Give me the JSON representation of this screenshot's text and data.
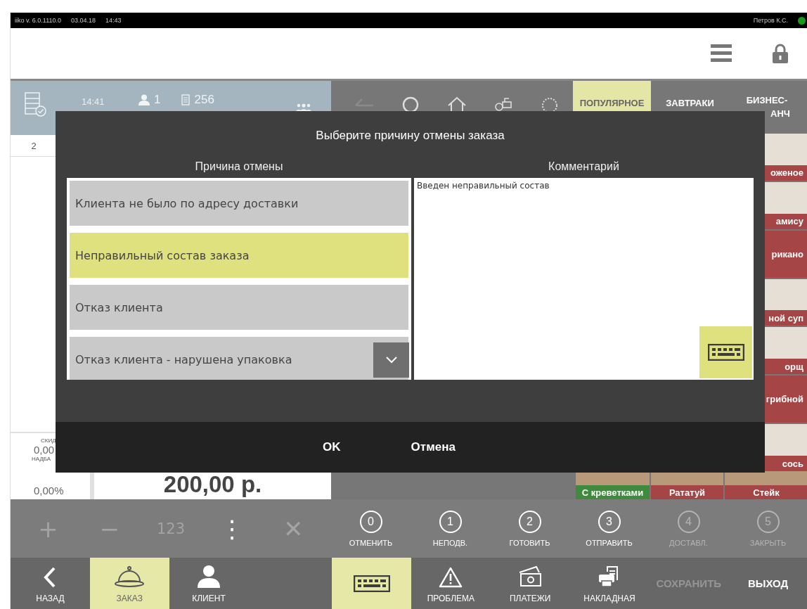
{
  "status_bar": {
    "app_version": "iiko  v. 6.0.1110.0",
    "date": "03.04.18",
    "time": "14:43",
    "user": "Петров К.С.",
    "online": true
  },
  "order": {
    "guests": "1",
    "order_number": "256",
    "time": "14:41",
    "row_number": "2",
    "discount_label": "СКИД",
    "discount_value": "0,00",
    "surcharge_label": "НАДБА",
    "surcharge_value": "0,00%",
    "total": "200,00 р."
  },
  "menu": {
    "categories": [
      {
        "lines": [
          "ПОПУЛЯРНОЕ"
        ],
        "selected": true
      },
      {
        "lines": [
          "ЗАВТРАКИ"
        ],
        "selected": false
      },
      {
        "lines": [
          "БИЗНЕС-",
          "АНЧ"
        ],
        "selected": false
      }
    ],
    "items": [
      {
        "name": "оженое",
        "kind": "photo"
      },
      {
        "name": "амису",
        "kind": "photo"
      },
      {
        "name": "рикано",
        "kind": "plain"
      },
      {
        "name": "ной суп",
        "kind": "photo"
      },
      {
        "name": "орщ",
        "kind": "photo"
      },
      {
        "name": "грибной",
        "kind": "plain"
      },
      {
        "name": "сось",
        "kind": "photo"
      }
    ],
    "bottom_items": [
      {
        "name": "С креветками",
        "color": "#3f8a3c"
      },
      {
        "name": "Рататуй",
        "color": "#a54545"
      },
      {
        "name": "Стейк",
        "color": "#a54545"
      }
    ]
  },
  "actions": {
    "tools": [
      {
        "symbol": "+",
        "disabled": true
      },
      {
        "symbol": "−",
        "disabled": true
      },
      {
        "symbol": "123",
        "disabled": true
      },
      {
        "symbol": "⋮",
        "disabled": false
      },
      {
        "symbol": "✕",
        "disabled": true
      }
    ],
    "statuses": [
      {
        "number": "0",
        "label": "ОТМЕНИТЬ",
        "disabled": false
      },
      {
        "number": "1",
        "label": "НЕПОДВ.",
        "disabled": false
      },
      {
        "number": "2",
        "label": "ГОТОВИТЬ",
        "disabled": false
      },
      {
        "number": "3",
        "label": "ОТПРАВИТЬ",
        "disabled": false
      },
      {
        "number": "4",
        "label": "ДОСТАВЛ.",
        "disabled": true
      },
      {
        "number": "5",
        "label": "ЗАКРЫТЬ",
        "disabled": true
      }
    ]
  },
  "nav": {
    "left": [
      {
        "label": "НАЗАД",
        "selected": false
      },
      {
        "label": "ЗАКАЗ",
        "selected": true
      },
      {
        "label": "КЛИЕНТ",
        "selected": false
      }
    ],
    "right": [
      {
        "kind": "keyboard",
        "selected": true
      },
      {
        "kind": "warning",
        "label": "ПРОБЛЕМА",
        "selected": false
      },
      {
        "kind": "money",
        "label": "ПЛАТЕЖИ",
        "selected": false
      },
      {
        "kind": "printer",
        "label": "НАКЛАДНАЯ",
        "selected": false
      },
      {
        "kind": "text",
        "label": "СОХРАНИТЬ",
        "disabled": true
      },
      {
        "kind": "text",
        "label": "ВЫХОД",
        "disabled": false
      }
    ]
  },
  "dialog": {
    "title": "Выберите причину отмены заказа",
    "reason_header": "Причина отмены",
    "comment_header": "Комментарий",
    "reasons": [
      {
        "label": "Клиента не было по адресу доставки",
        "selected": false
      },
      {
        "label": "Неправильный состав заказа",
        "selected": true
      },
      {
        "label": "Отказ клиента",
        "selected": false
      },
      {
        "label": "Отказ клиента - нарушена упаковка",
        "selected": false
      }
    ],
    "comment": "Введен неправильный состав",
    "buttons": [
      "OK",
      "Отмена"
    ]
  }
}
